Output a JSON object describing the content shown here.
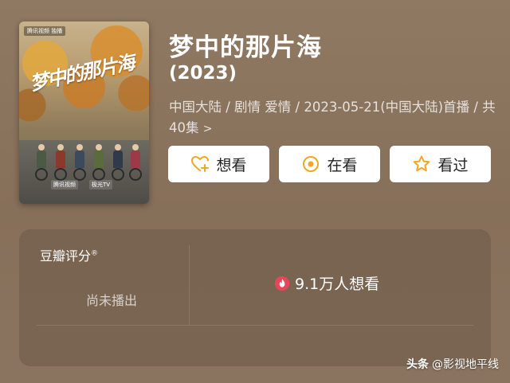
{
  "poster": {
    "title_art": "梦中的那片海",
    "badge": "腾讯视频 独播",
    "logos": [
      "腾讯视频",
      "极光TV"
    ]
  },
  "header": {
    "title": "梦中的那片海",
    "year": "(2023)",
    "meta": "中国大陆 / 剧情 爱情 / 2023-05-21(中国大陆)首播 / 共40集",
    "meta_chevron": ">"
  },
  "actions": {
    "want": "想看",
    "watching": "在看",
    "watched": "看过"
  },
  "rating": {
    "label": "豆瓣评分",
    "label_mark": "®",
    "status": "尚未播出",
    "want_count": "9.1万人想看"
  },
  "watermark": {
    "platform": "头条",
    "account": "@影视地平线"
  },
  "colors": {
    "background": "#8a735c",
    "button_bg": "#ffffff",
    "icon_orange": "#f2a623",
    "fire_red": "#e8455a"
  }
}
